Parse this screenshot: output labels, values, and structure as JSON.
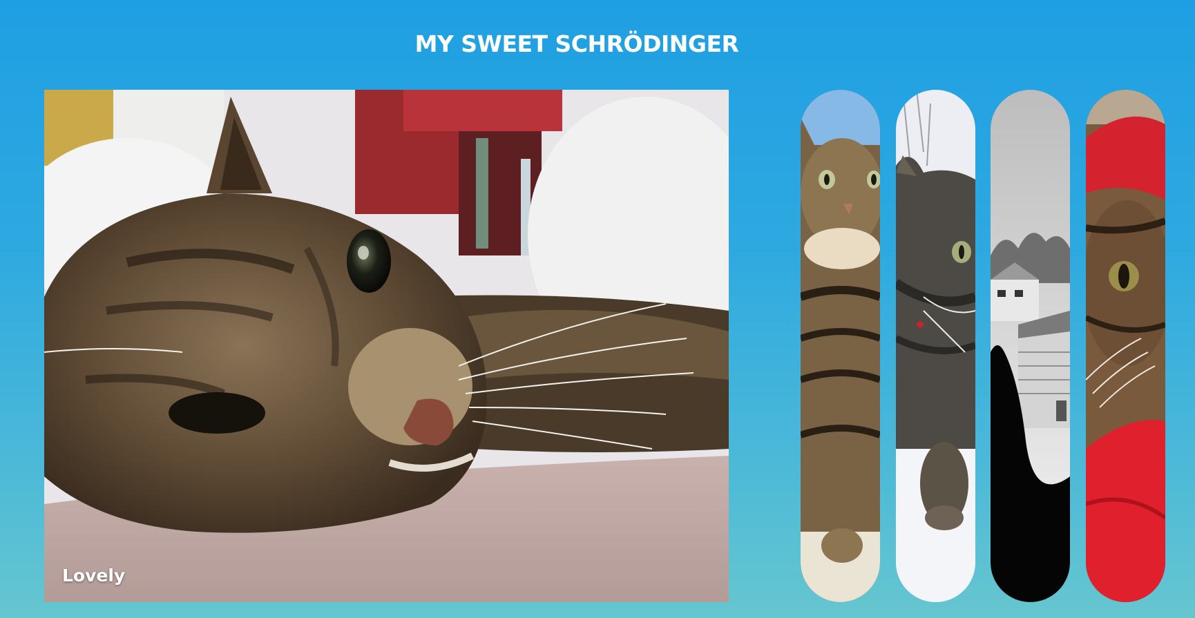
{
  "header": {
    "title": "MY SWEET SCHRÖDINGER"
  },
  "gallery": {
    "featured": {
      "caption": "Lovely",
      "icon": "cat-photo"
    },
    "thumbnails": [
      {
        "icon": "cat-photo"
      },
      {
        "icon": "cat-photo"
      },
      {
        "icon": "cat-photo"
      },
      {
        "icon": "cat-photo"
      }
    ]
  },
  "colors": {
    "background_top": "#1f9fe3",
    "background_bottom": "#66c6cf",
    "text": "#ffffff"
  }
}
